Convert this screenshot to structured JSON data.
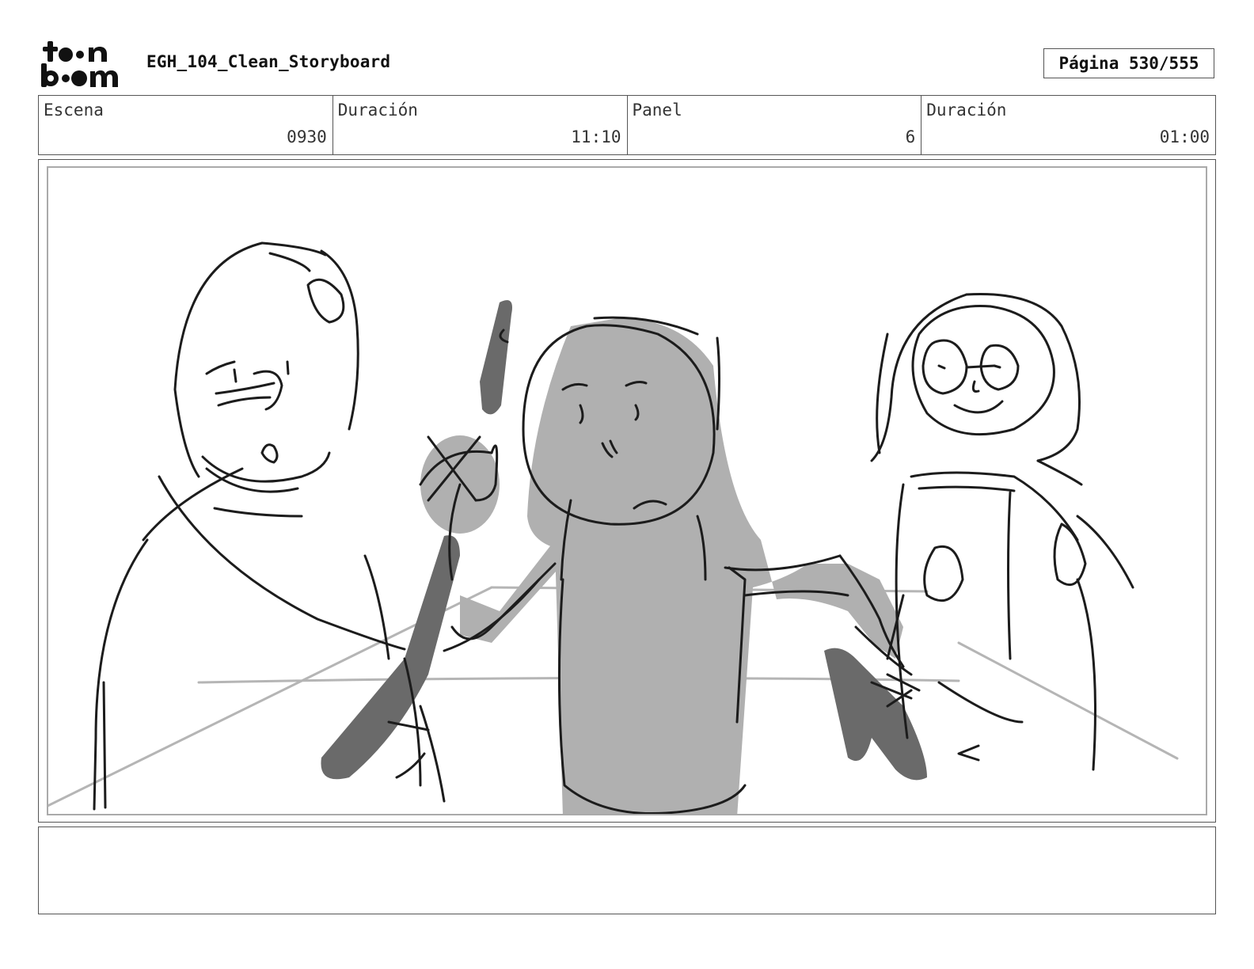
{
  "brand": {
    "logo_top": "toon",
    "logo_bottom": "boom"
  },
  "header": {
    "title": "EGH_104_Clean_Storyboard",
    "page": "Página 530/555"
  },
  "info": {
    "scene_label": "Escena",
    "scene_value": "0930",
    "scene_duration_label": "Duración",
    "scene_duration_value": "11:10",
    "panel_label": "Panel",
    "panel_value": "6",
    "panel_duration_label": "Duración",
    "panel_duration_value": "01:00"
  },
  "notes": {
    "text": ""
  }
}
